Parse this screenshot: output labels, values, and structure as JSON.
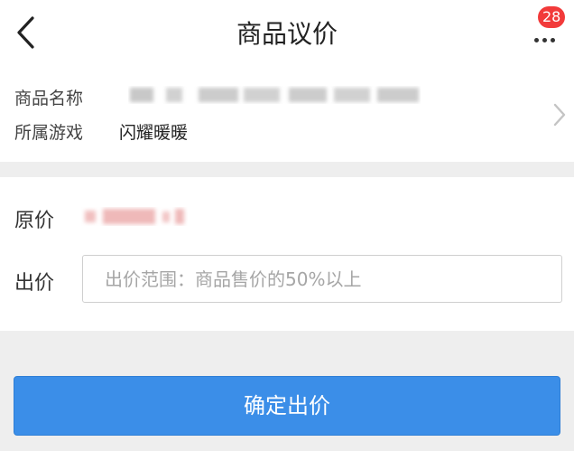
{
  "header": {
    "title": "商品议价",
    "badge_count": "28",
    "back_icon": "chevron-left-icon",
    "more_icon": "more-dots-icon"
  },
  "product": {
    "name_label": "商品名称",
    "game_label": "所属游戏",
    "game_value": "闪耀暖暖"
  },
  "price": {
    "original_label": "原价",
    "offer_label": "出价",
    "offer_placeholder": "出价范围：商品售价的50%以上",
    "offer_value": ""
  },
  "actions": {
    "confirm_label": "确定出价"
  },
  "colors": {
    "accent": "#3b8ee8",
    "badge": "#f23a3a",
    "background": "#eeeeee"
  }
}
